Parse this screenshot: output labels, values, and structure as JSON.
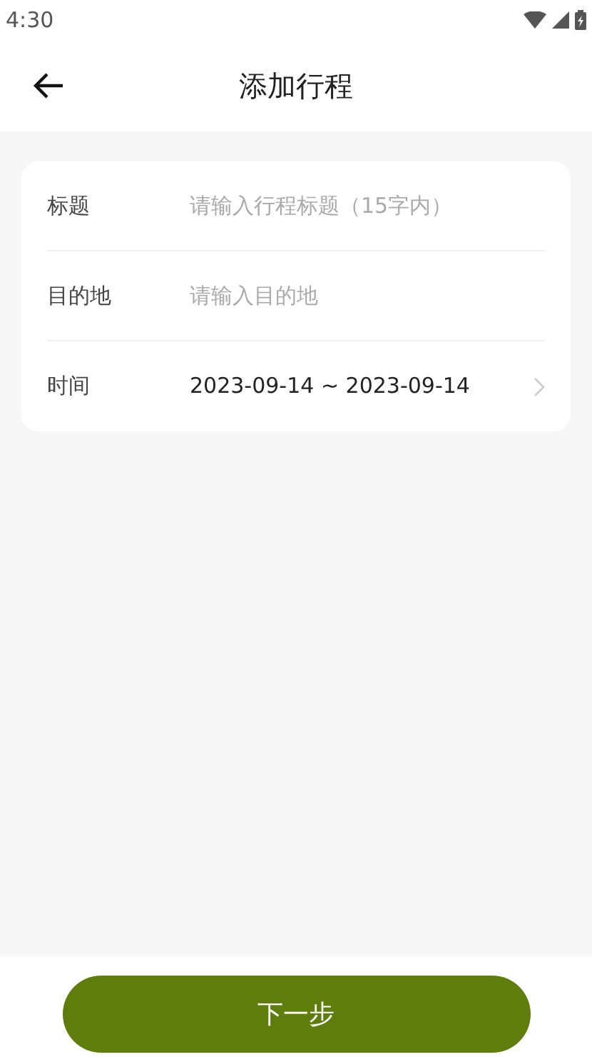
{
  "status_bar": {
    "time": "4:30"
  },
  "header": {
    "title": "添加行程"
  },
  "form": {
    "rows": [
      {
        "kind": "input",
        "label": "标题",
        "placeholder": "请输入行程标题（15字内）"
      },
      {
        "kind": "input",
        "label": "目的地",
        "placeholder": "请输入目的地"
      },
      {
        "kind": "picker",
        "label": "时间",
        "value": "2023-09-14 ~ 2023-09-14"
      }
    ]
  },
  "footer": {
    "button": "下一步"
  }
}
